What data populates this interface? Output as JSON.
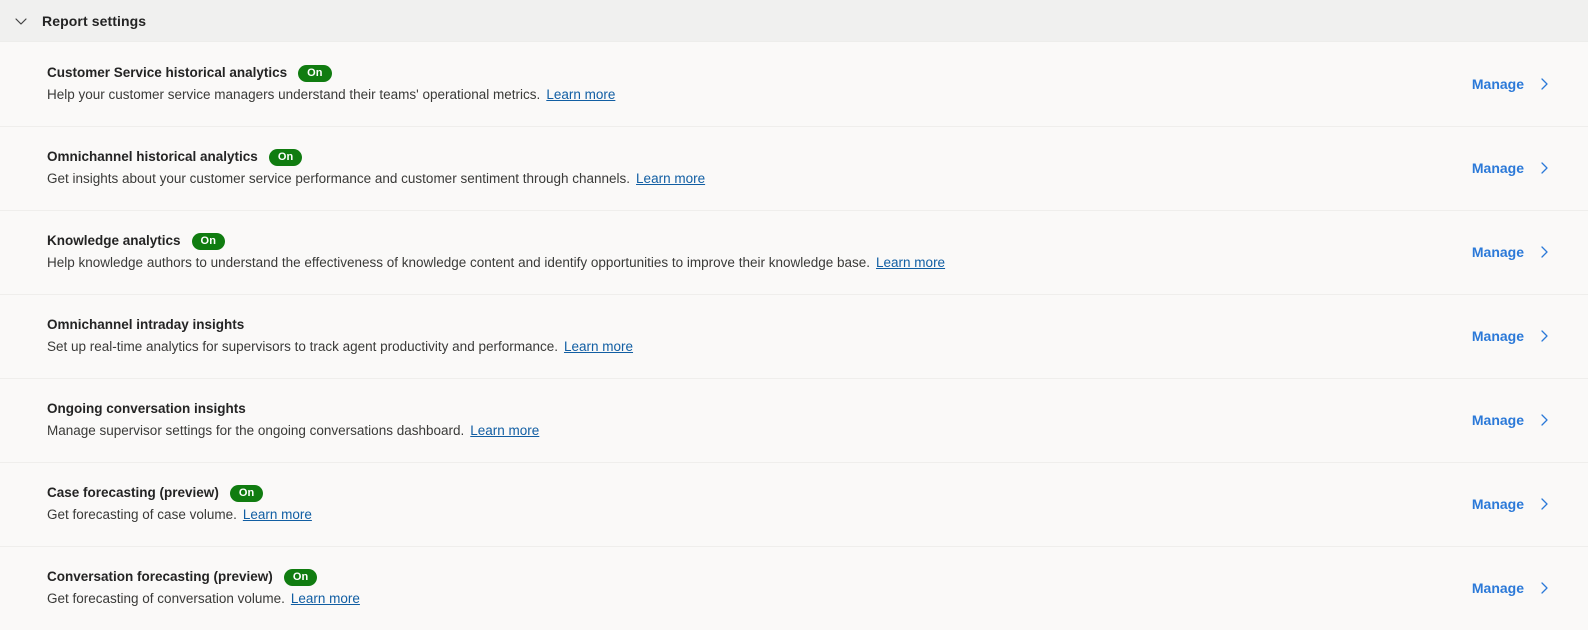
{
  "header": {
    "title": "Report settings",
    "collapse_icon": "chevron-down-icon"
  },
  "common": {
    "manage_label": "Manage",
    "manage_icon": "chevron-right-icon",
    "learn_more_label": "Learn more",
    "badge_on_label": "On",
    "accent_link_color": "#2b79d8",
    "inline_link_color": "#115ea3",
    "badge_color": "#107c10",
    "header_bg": "#f0f0ef",
    "body_bg": "#faf9f8"
  },
  "rows": [
    {
      "title": "Customer Service historical analytics",
      "badge": "On",
      "description": "Help your customer service managers understand their teams' operational metrics.",
      "learn_more": "Learn more",
      "action": "Manage"
    },
    {
      "title": "Omnichannel historical analytics",
      "badge": "On",
      "description": "Get insights about your customer service performance and customer sentiment through channels.",
      "learn_more": "Learn more",
      "action": "Manage"
    },
    {
      "title": "Knowledge analytics",
      "badge": "On",
      "description": "Help knowledge authors to understand the effectiveness of knowledge content and identify opportunities to improve their knowledge base.",
      "learn_more": "Learn more",
      "action": "Manage"
    },
    {
      "title": "Omnichannel intraday insights",
      "badge": "",
      "description": "Set up real-time analytics for supervisors to track agent productivity and performance.",
      "learn_more": "Learn more",
      "action": "Manage"
    },
    {
      "title": "Ongoing conversation insights",
      "badge": "",
      "description": "Manage supervisor settings for the ongoing conversations dashboard.",
      "learn_more": "Learn more",
      "action": "Manage"
    },
    {
      "title": "Case forecasting (preview)",
      "badge": "On",
      "description": "Get forecasting of case volume.",
      "learn_more": "Learn more",
      "action": "Manage"
    },
    {
      "title": "Conversation forecasting (preview)",
      "badge": "On",
      "description": "Get forecasting of conversation volume.",
      "learn_more": "Learn more",
      "action": "Manage"
    }
  ]
}
